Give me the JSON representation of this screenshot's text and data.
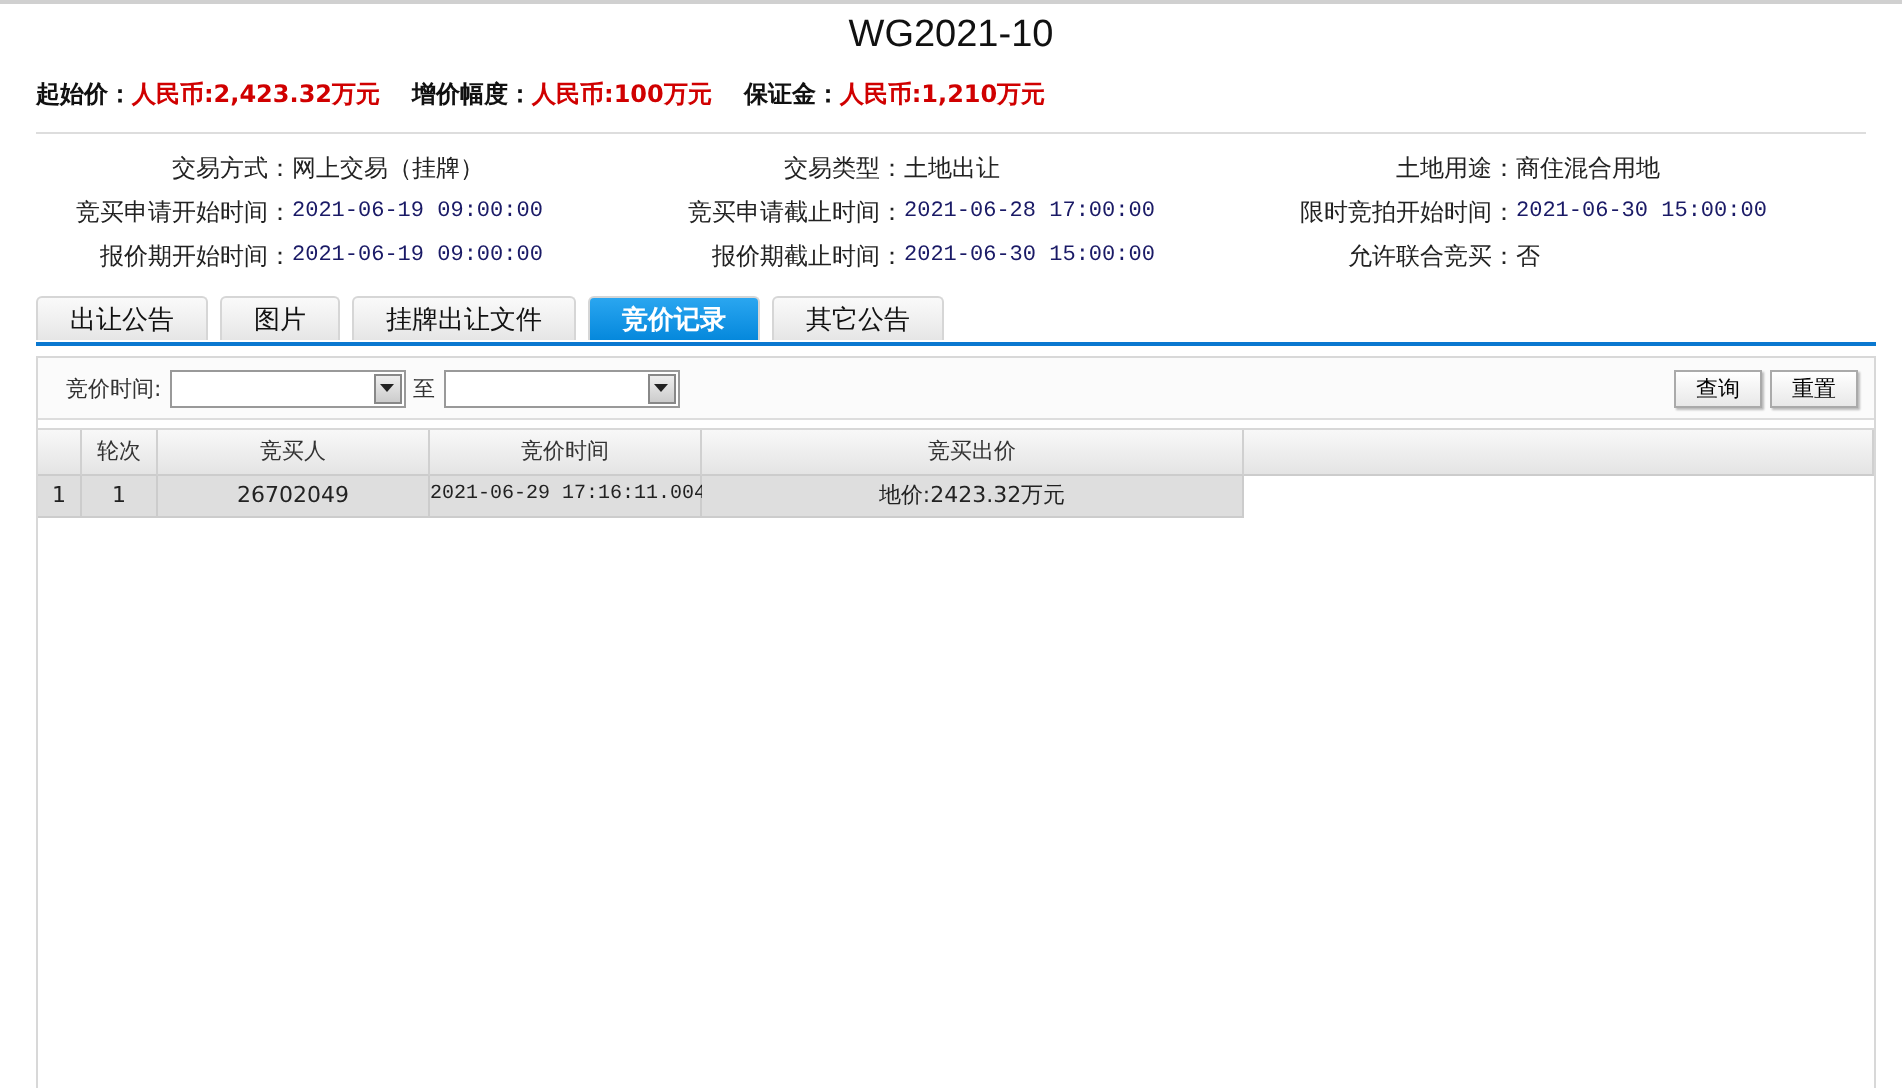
{
  "title": "WG2021-10",
  "fees": [
    {
      "label": "起始价：",
      "value": "人民币:2,423.32万元"
    },
    {
      "label": "增价幅度：",
      "value": "人民币:100万元"
    },
    {
      "label": "保证金：",
      "value": "人民币:1,210万元"
    }
  ],
  "info": [
    {
      "label": "交易方式：",
      "value": "网上交易（挂牌）",
      "kind": "text"
    },
    {
      "label": "交易类型：",
      "value": "土地出让",
      "kind": "text"
    },
    {
      "label": "土地用途：",
      "value": "商住混合用地",
      "kind": "text"
    },
    {
      "label": "竞买申请开始时间：",
      "value": "2021-06-19 09:00:00",
      "kind": "date"
    },
    {
      "label": "竞买申请截止时间：",
      "value": "2021-06-28 17:00:00",
      "kind": "date"
    },
    {
      "label": "限时竞拍开始时间：",
      "value": "2021-06-30 15:00:00",
      "kind": "date"
    },
    {
      "label": "报价期开始时间：",
      "value": "2021-06-19 09:00:00",
      "kind": "date"
    },
    {
      "label": "报价期截止时间：",
      "value": "2021-06-30 15:00:00",
      "kind": "date"
    },
    {
      "label": "允许联合竞买：",
      "value": "否",
      "kind": "text"
    }
  ],
  "tabs": [
    {
      "label": "出让公告",
      "selected": false
    },
    {
      "label": "图片",
      "selected": false
    },
    {
      "label": "挂牌出让文件",
      "selected": false
    },
    {
      "label": "竞价记录",
      "selected": true
    },
    {
      "label": "其它公告",
      "selected": false
    }
  ],
  "filter": {
    "label": "竞价时间:",
    "separator": "至",
    "buttons": [
      "查询",
      "重置"
    ]
  },
  "table": {
    "columns": [
      "轮次",
      "竞买人",
      "竞价时间",
      "竞买出价"
    ],
    "rows": [
      {
        "index": "1",
        "cells": [
          "1",
          "26702049",
          "2021-06-29 17:16:11.004",
          "地价:2423.32万元"
        ]
      }
    ]
  }
}
